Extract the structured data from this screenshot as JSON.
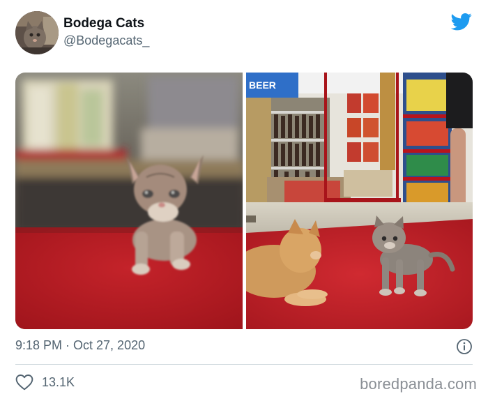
{
  "tweet": {
    "display_name": "Bodega Cats",
    "handle": "@Bodegacats_",
    "timestamp": "9:18 PM · Oct 27, 2020",
    "like_count": "13.1K"
  },
  "photos": {
    "right": {
      "shop_sign": "BEER"
    }
  },
  "watermark": "boredpanda.com",
  "icons": {
    "logo": "twitter-bird-icon",
    "info": "info-icon",
    "like": "heart-icon"
  },
  "colors": {
    "twitter_blue": "#1d9bf0",
    "secondary_text": "#536471",
    "divider": "#cfd9de"
  }
}
